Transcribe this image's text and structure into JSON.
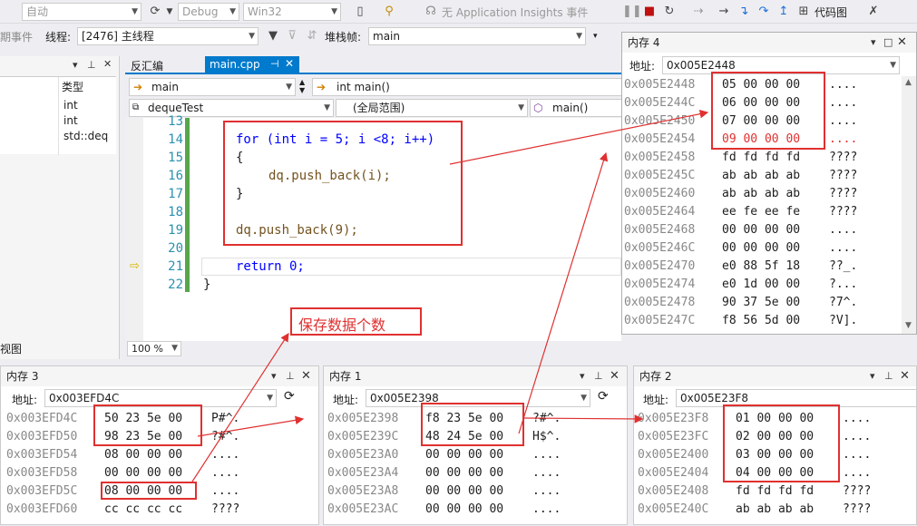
{
  "toolbar1": {
    "config_auto": "自动",
    "config_debug": "Debug",
    "config_platform": "Win32",
    "app_insights": "无 Application Insights 事件",
    "code_map": "代码图"
  },
  "toolbar2": {
    "events_label": "期事件",
    "thread_label": "线程:",
    "thread_value": "[2476] 主线程",
    "stackframe_label": "堆栈帧:",
    "stackframe_value": "main"
  },
  "left_panel": {
    "type_header": "类型",
    "types": [
      "int",
      "int",
      "std::deq"
    ],
    "bottom_tab": "视图"
  },
  "editor": {
    "tabs": [
      {
        "label": "反汇编",
        "active": false
      },
      {
        "label": "main.cpp",
        "active": true
      }
    ],
    "nav_scope": "main",
    "nav_func": "int main()",
    "project": "dequeTest",
    "global_scope": "(全局范围)",
    "member": "main()",
    "zoom": "100 %",
    "lines": [
      {
        "num": "13",
        "code": ""
      },
      {
        "num": "14",
        "code": "for (int i = 5; i <8; i++)"
      },
      {
        "num": "15",
        "code": "{"
      },
      {
        "num": "16",
        "code": "dq.push_back(i);"
      },
      {
        "num": "17",
        "code": "}"
      },
      {
        "num": "18",
        "code": ""
      },
      {
        "num": "19",
        "code": "dq.push_back(9);"
      },
      {
        "num": "20",
        "code": ""
      },
      {
        "num": "21",
        "code": "return 0;"
      },
      {
        "num": "22",
        "code": "}"
      }
    ]
  },
  "annotation": "保存数据个数",
  "memory4": {
    "title": "内存 4",
    "addr_label": "地址:",
    "addr_value": "0x005E2448",
    "rows": [
      {
        "addr": "0x005E2448",
        "bytes": "05 00 00 00",
        "ascii": "...."
      },
      {
        "addr": "0x005E244C",
        "bytes": "06 00 00 00",
        "ascii": "...."
      },
      {
        "addr": "0x005E2450",
        "bytes": "07 00 00 00",
        "ascii": "...."
      },
      {
        "addr": "0x005E2454",
        "bytes": "09 00 00 00",
        "ascii": "...."
      },
      {
        "addr": "0x005E2458",
        "bytes": "fd fd fd fd",
        "ascii": "????"
      },
      {
        "addr": "0x005E245C",
        "bytes": "ab ab ab ab",
        "ascii": "????"
      },
      {
        "addr": "0x005E2460",
        "bytes": "ab ab ab ab",
        "ascii": "????"
      },
      {
        "addr": "0x005E2464",
        "bytes": "ee fe ee fe",
        "ascii": "????"
      },
      {
        "addr": "0x005E2468",
        "bytes": "00 00 00 00",
        "ascii": "...."
      },
      {
        "addr": "0x005E246C",
        "bytes": "00 00 00 00",
        "ascii": "...."
      },
      {
        "addr": "0x005E2470",
        "bytes": "e0 88 5f 18",
        "ascii": "??_."
      },
      {
        "addr": "0x005E2474",
        "bytes": "e0 1d 00 00",
        "ascii": "?..."
      },
      {
        "addr": "0x005E2478",
        "bytes": "90 37 5e 00",
        "ascii": "?7^."
      },
      {
        "addr": "0x005E247C",
        "bytes": "f8 56 5d 00",
        "ascii": "?V]."
      }
    ]
  },
  "memory3": {
    "title": "内存 3",
    "addr_label": "地址:",
    "addr_value": "0x003EFD4C",
    "rows": [
      {
        "addr": "0x003EFD4C",
        "bytes": "50 23 5e 00",
        "ascii": "P#^."
      },
      {
        "addr": "0x003EFD50",
        "bytes": "98 23 5e 00",
        "ascii": "?#^."
      },
      {
        "addr": "0x003EFD54",
        "bytes": "08 00 00 00",
        "ascii": "...."
      },
      {
        "addr": "0x003EFD58",
        "bytes": "00 00 00 00",
        "ascii": "...."
      },
      {
        "addr": "0x003EFD5C",
        "bytes": "08 00 00 00",
        "ascii": "...."
      },
      {
        "addr": "0x003EFD60",
        "bytes": "cc cc cc cc",
        "ascii": "????"
      }
    ]
  },
  "memory1": {
    "title": "内存 1",
    "addr_label": "地址:",
    "addr_value": "0x005E2398",
    "rows": [
      {
        "addr": "0x005E2398",
        "bytes": "f8 23 5e 00",
        "ascii": "?#^."
      },
      {
        "addr": "0x005E239C",
        "bytes": "48 24 5e 00",
        "ascii": "H$^."
      },
      {
        "addr": "0x005E23A0",
        "bytes": "00 00 00 00",
        "ascii": "...."
      },
      {
        "addr": "0x005E23A4",
        "bytes": "00 00 00 00",
        "ascii": "...."
      },
      {
        "addr": "0x005E23A8",
        "bytes": "00 00 00 00",
        "ascii": "...."
      },
      {
        "addr": "0x005E23AC",
        "bytes": "00 00 00 00",
        "ascii": "...."
      }
    ]
  },
  "memory2": {
    "title": "内存 2",
    "addr_label": "地址:",
    "addr_value": "0x005E23F8",
    "rows": [
      {
        "addr": "0x005E23F8",
        "bytes": "01 00 00 00",
        "ascii": "...."
      },
      {
        "addr": "0x005E23FC",
        "bytes": "02 00 00 00",
        "ascii": "...."
      },
      {
        "addr": "0x005E2400",
        "bytes": "03 00 00 00",
        "ascii": "...."
      },
      {
        "addr": "0x005E2404",
        "bytes": "04 00 00 00",
        "ascii": "...."
      },
      {
        "addr": "0x005E2408",
        "bytes": "fd fd fd fd",
        "ascii": "????"
      },
      {
        "addr": "0x005E240C",
        "bytes": "ab ab ab ab",
        "ascii": "????"
      }
    ]
  }
}
